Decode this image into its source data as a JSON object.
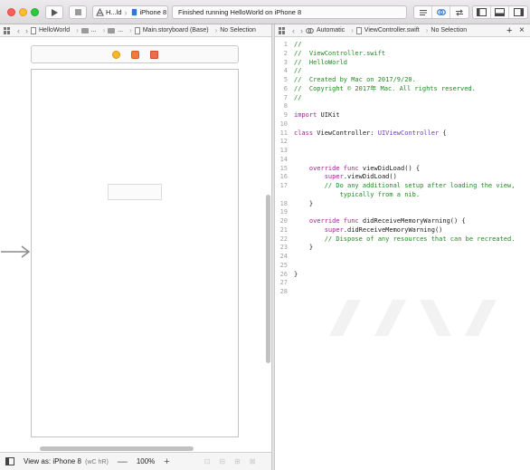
{
  "toolbar": {
    "scheme_target": "H...ld",
    "scheme_device": "iPhone 8",
    "scheme_separator": "›",
    "status": "Finished running HelloWorld on iPhone 8"
  },
  "jumpbar_left": {
    "project": "HelloWorld",
    "folder1": "...",
    "folder2": "...",
    "file": "Main.storyboard (Base)",
    "selection": "No Selection"
  },
  "jumpbar_right": {
    "mode": "Automatic",
    "file": "ViewController.swift",
    "selection": "No Selection"
  },
  "ib_bottom": {
    "view_as_label": "View as: iPhone 8",
    "view_as_sizeclass": "(wC hR)",
    "zoom_out": "—",
    "zoom_value": "100%",
    "zoom_in": "+"
  },
  "code": [
    {
      "n": "1",
      "tokens": [
        {
          "t": "//",
          "k": "comment"
        }
      ]
    },
    {
      "n": "2",
      "tokens": [
        {
          "t": "//  ViewController.swift",
          "k": "comment"
        }
      ]
    },
    {
      "n": "3",
      "tokens": [
        {
          "t": "//  HelloWorld",
          "k": "comment"
        }
      ]
    },
    {
      "n": "4",
      "tokens": [
        {
          "t": "//",
          "k": "comment"
        }
      ]
    },
    {
      "n": "5",
      "tokens": [
        {
          "t": "//  Created by Mac on 2017/9/20.",
          "k": "comment"
        }
      ]
    },
    {
      "n": "6",
      "tokens": [
        {
          "t": "//  Copyright © 2017年 Mac. All rights reserved.",
          "k": "comment"
        }
      ]
    },
    {
      "n": "7",
      "tokens": [
        {
          "t": "//",
          "k": "comment"
        }
      ]
    },
    {
      "n": "8",
      "tokens": []
    },
    {
      "n": "9",
      "tokens": [
        {
          "t": "import",
          "k": "keyword"
        },
        {
          "t": " UIKit",
          "k": "plain"
        }
      ]
    },
    {
      "n": "10",
      "tokens": []
    },
    {
      "n": "11",
      "tokens": [
        {
          "t": "class",
          "k": "keyword"
        },
        {
          "t": " ViewController: ",
          "k": "plain"
        },
        {
          "t": "UIViewController",
          "k": "type"
        },
        {
          "t": " {",
          "k": "plain"
        }
      ]
    },
    {
      "n": "12",
      "tokens": []
    },
    {
      "n": "13",
      "tokens": []
    },
    {
      "n": "14",
      "tokens": []
    },
    {
      "n": "15",
      "tokens": [
        {
          "t": "    override func",
          "k": "keyword"
        },
        {
          "t": " viewDidLoad() {",
          "k": "plain"
        }
      ]
    },
    {
      "n": "16",
      "tokens": [
        {
          "t": "        super",
          "k": "keyword"
        },
        {
          "t": ".viewDidLoad()",
          "k": "plain"
        }
      ]
    },
    {
      "n": "17",
      "tokens": [
        {
          "t": "        // Do any additional setup after loading the view,",
          "k": "comment"
        }
      ]
    },
    {
      "n": "",
      "tokens": [
        {
          "t": "            typically from a nib.",
          "k": "comment"
        }
      ]
    },
    {
      "n": "18",
      "tokens": [
        {
          "t": "    }",
          "k": "plain"
        }
      ]
    },
    {
      "n": "19",
      "tokens": []
    },
    {
      "n": "20",
      "tokens": [
        {
          "t": "    override func",
          "k": "keyword"
        },
        {
          "t": " didReceiveMemoryWarning() {",
          "k": "plain"
        }
      ]
    },
    {
      "n": "21",
      "tokens": [
        {
          "t": "        super",
          "k": "keyword"
        },
        {
          "t": ".didReceiveMemoryWarning()",
          "k": "plain"
        }
      ]
    },
    {
      "n": "22",
      "tokens": [
        {
          "t": "        // Dispose of any resources that can be recreated.",
          "k": "comment"
        }
      ]
    },
    {
      "n": "23",
      "tokens": [
        {
          "t": "    }",
          "k": "plain"
        }
      ]
    },
    {
      "n": "24",
      "tokens": []
    },
    {
      "n": "25",
      "tokens": []
    },
    {
      "n": "26",
      "tokens": [
        {
          "t": "}",
          "k": "plain"
        }
      ]
    },
    {
      "n": "27",
      "tokens": []
    },
    {
      "n": "28",
      "tokens": []
    }
  ],
  "colors": {
    "comment": "#1f8a1f",
    "keyword": "#a3218f",
    "type": "#6a3eb0"
  },
  "icons": [
    "play-icon",
    "stop-icon",
    "editor-standard-icon",
    "editor-assistant-icon",
    "editor-version-icon",
    "navigator-toggle-icon",
    "debug-toggle-icon",
    "utilities-toggle-icon"
  ]
}
